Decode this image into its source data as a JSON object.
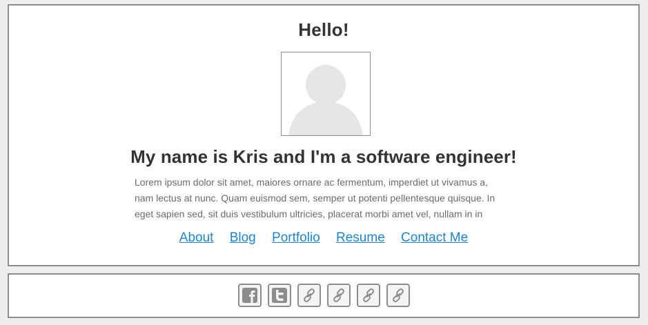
{
  "header": {
    "greeting": "Hello!"
  },
  "profile": {
    "avatar_icon": "user-silhouette-icon",
    "tagline": "My name is Kris and I'm a software engineer!",
    "bio_lines": [
      "Lorem ipsum dolor sit amet, maiores ornare ac fermentum, imperdiet ut vivamus a,",
      "nam lectus at nunc. Quam euismod sem, semper ut potenti pellentesque quisque. In",
      "eget sapien sed, sit duis vestibulum ultricies, placerat morbi amet vel, nullam in in"
    ]
  },
  "nav": {
    "links": [
      {
        "label": "About"
      },
      {
        "label": "Blog"
      },
      {
        "label": "Portfolio"
      },
      {
        "label": "Resume"
      },
      {
        "label": "Contact Me"
      }
    ],
    "link_color": "#1f84cf"
  },
  "social": {
    "buttons": [
      {
        "icon": "facebook-icon"
      },
      {
        "icon": "twitter-icon"
      },
      {
        "icon": "link-icon"
      },
      {
        "icon": "link-icon"
      },
      {
        "icon": "link-icon"
      },
      {
        "icon": "link-icon"
      }
    ],
    "icon_color": "#8c8c8c"
  }
}
